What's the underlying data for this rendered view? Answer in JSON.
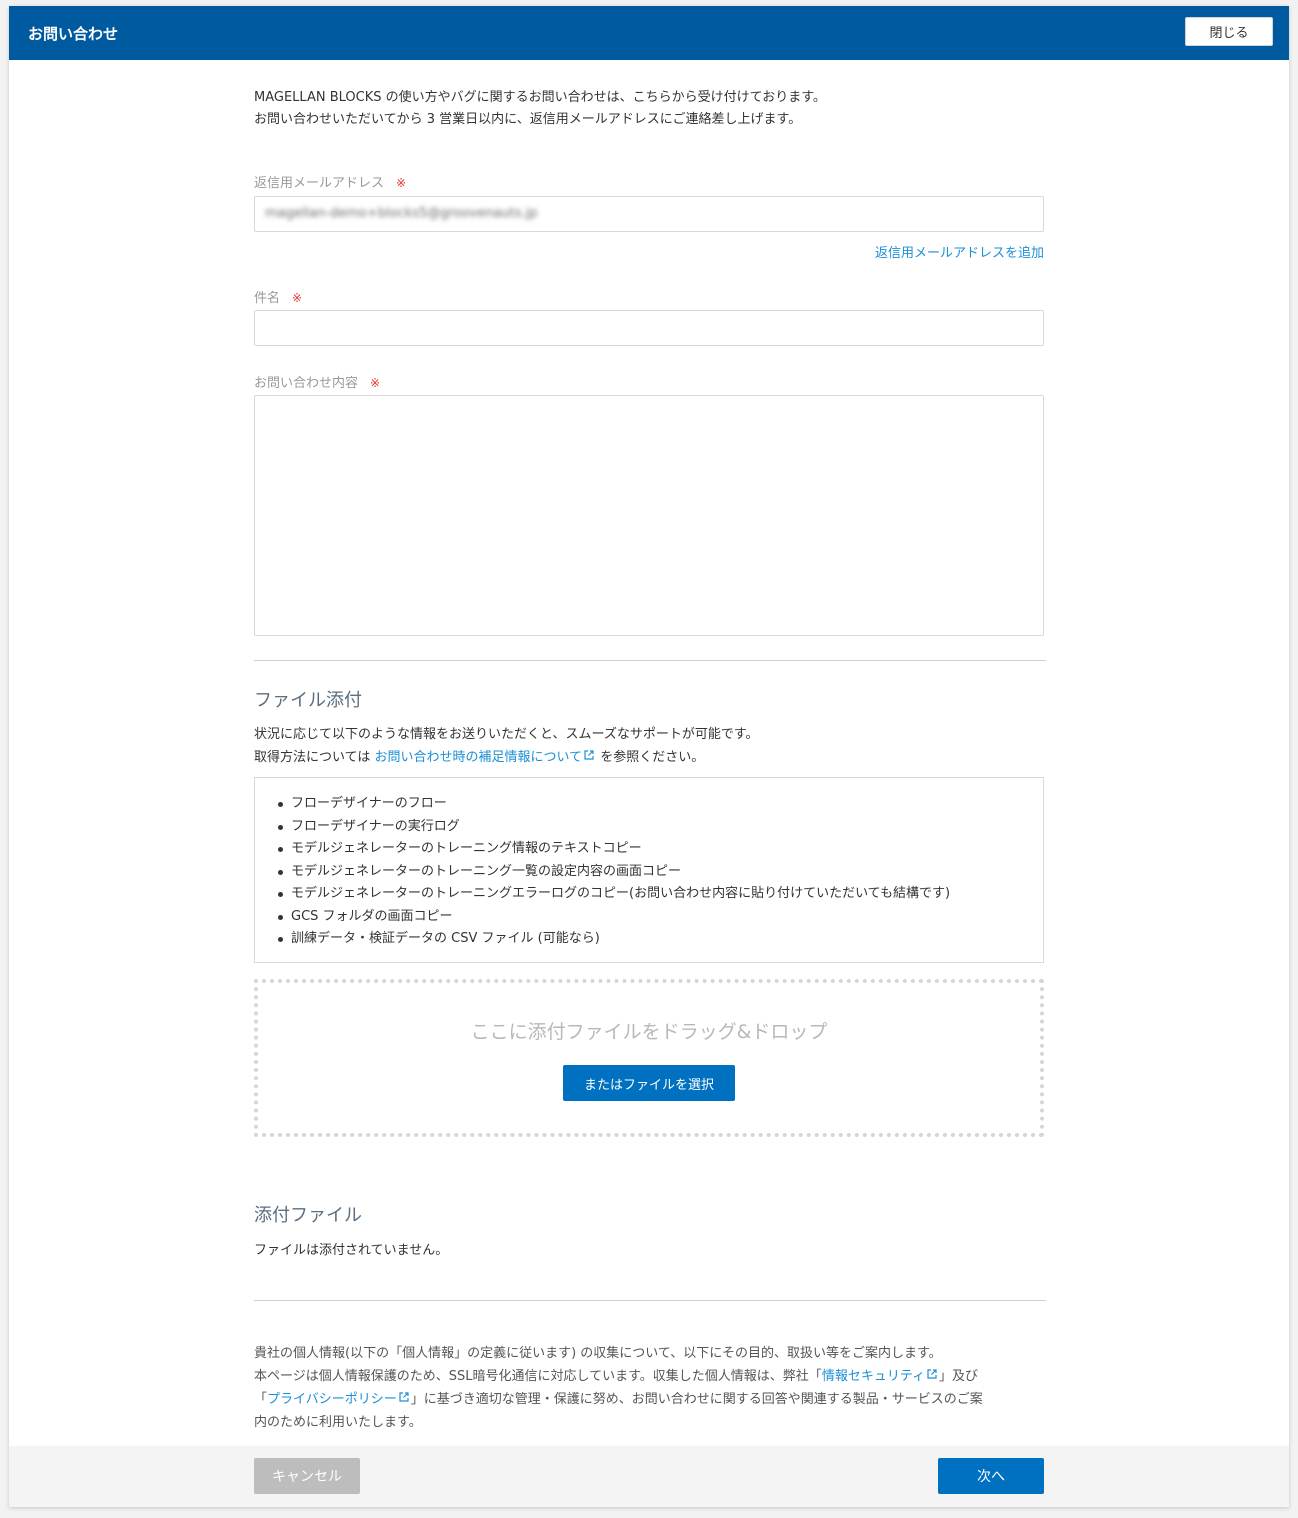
{
  "dialog": {
    "title": "お問い合わせ",
    "close_label": "閉じる"
  },
  "intro": {
    "line1": "MAGELLAN BLOCKS の使い方やバグに関するお問い合わせは、こちらから受け付けております。",
    "line2": "お問い合わせいただいてから 3 営業日以内に、返信用メールアドレスにご連絡差し上げます。"
  },
  "form": {
    "required_mark": "※",
    "email_label": "返信用メールアドレス",
    "email_value": "magellan-demo+blocks5@groovenauts.jp",
    "add_email_link": "返信用メールアドレスを追加",
    "subject_label": "件名",
    "subject_value": "",
    "body_label": "お問い合わせ内容",
    "body_value": ""
  },
  "attach": {
    "title": "ファイル添付",
    "desc1": "状況に応じて以下のような情報をお送りいただくと、スムーズなサポートが可能です。",
    "desc2_prefix": "取得方法については ",
    "desc2_link": "お問い合わせ時の補足情報について",
    "desc2_suffix": " を参照ください。",
    "items": [
      "フローデザイナーのフロー",
      "フローデザイナーの実行ログ",
      "モデルジェネレーターのトレーニング情報のテキストコピー",
      "モデルジェネレーターのトレーニング一覧の設定内容の画面コピー",
      "モデルジェネレーターのトレーニングエラーログのコピー(お問い合わせ内容に貼り付けていただいても結構です)",
      "GCS フォルダの画面コピー",
      "訓練データ・検証データの CSV ファイル (可能なら)"
    ],
    "drop_text": "ここに添付ファイルをドラッグ&ドロップ",
    "select_button": "またはファイルを選択"
  },
  "attached": {
    "title": "添付ファイル",
    "empty": "ファイルは添付されていません。"
  },
  "privacy": {
    "line1": "貴社の個人情報(以下の「個人情報」の定義に従います) の収集について、以下にその目的、取扱い等をご案内します。",
    "line2_prefix": "本ページは個人情報保護のため、SSL暗号化通信に対応しています。収集した個人情報は、弊社「",
    "security_link": "情報セキュリティ",
    "line2_mid": "」及び",
    "line3_prefix": "「",
    "privacy_link": "プライバシーポリシー",
    "line3_suffix": "」に基づき適切な管理・保護に努め、お問い合わせに関する回答や関連する製品・サービスのご案",
    "line4": "内のために利用いたします。"
  },
  "footer": {
    "cancel_label": "キャンセル",
    "next_label": "次へ"
  },
  "colors": {
    "header": "#005aa0",
    "primary_button": "#0070c0",
    "link": "#1a8fd6",
    "required": "#e53935"
  }
}
